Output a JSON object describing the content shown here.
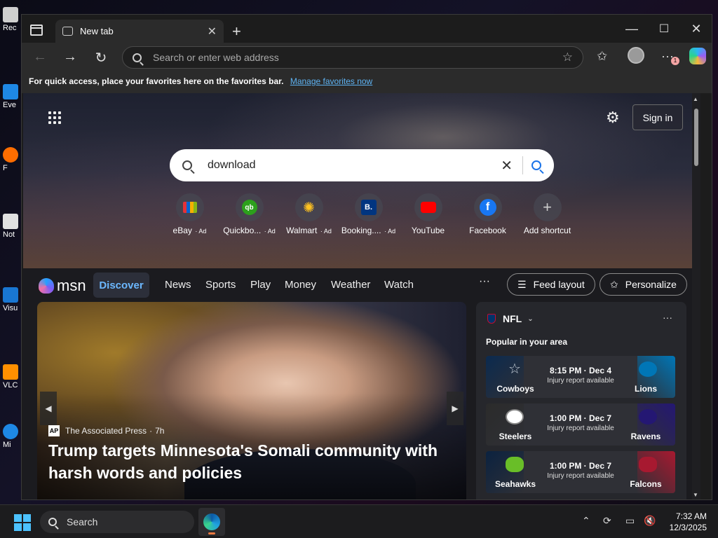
{
  "desktop": {
    "icons": [
      {
        "label": "Rec",
        "color": "#cfcfcf"
      },
      {
        "label": "Eve",
        "color": "#1e88e5"
      },
      {
        "label": "F",
        "color": "#ff6d00"
      },
      {
        "label": "Not",
        "color": "#e0e0e0"
      },
      {
        "label": "Visu",
        "color": "#1976d2"
      },
      {
        "label": "VLC",
        "color": "#ff8f00"
      },
      {
        "label": "Mi",
        "color": "#1e88e5"
      }
    ]
  },
  "browser": {
    "tab": {
      "title": "New tab"
    },
    "address": {
      "placeholder": "Search or enter web address"
    },
    "favbar": {
      "text": "For quick access, place your favorites here on the favorites bar.",
      "link": "Manage favorites now"
    },
    "notification_count": "1"
  },
  "newtab": {
    "sign_in": "Sign in",
    "search": {
      "value": "download"
    },
    "shortcuts": [
      {
        "label": "eBay",
        "ad": "Ad",
        "icon": "ebay-icon"
      },
      {
        "label": "Quickbo...",
        "ad": "Ad",
        "icon": "quickbooks-icon"
      },
      {
        "label": "Walmart",
        "ad": "Ad",
        "icon": "walmart-icon"
      },
      {
        "label": "Booking....",
        "ad": "Ad",
        "icon": "booking-icon"
      },
      {
        "label": "YouTube",
        "ad": "",
        "icon": "youtube-icon"
      },
      {
        "label": "Facebook",
        "ad": "",
        "icon": "facebook-icon"
      },
      {
        "label": "Add shortcut",
        "ad": "",
        "icon": "plus-icon"
      }
    ]
  },
  "msn": {
    "logo": "msn",
    "nav": [
      "Discover",
      "News",
      "Sports",
      "Play",
      "Money",
      "Weather",
      "Watch"
    ],
    "more": "···",
    "feed_layout": "Feed layout",
    "personalize": "Personalize",
    "feature": {
      "source": "The Associated Press",
      "age": "7h",
      "headline": "Trump targets Minnesota's Somali community with harsh words and policies"
    },
    "nfl": {
      "title": "NFL",
      "subtitle": "Popular in your area",
      "games": [
        {
          "home": "Cowboys",
          "away": "Lions",
          "time": "8:15 PM · Dec 4",
          "note": "Injury report available",
          "home_color": "#0b2a4f",
          "away_color": "#0076b6"
        },
        {
          "home": "Steelers",
          "away": "Ravens",
          "time": "1:00 PM · Dec 7",
          "note": "Injury report available",
          "home_color": "#2b2b2b",
          "away_color": "#241773"
        },
        {
          "home": "Seahawks",
          "away": "Falcons",
          "time": "1:00 PM · Dec 7",
          "note": "Injury report available",
          "home_color": "#0b2240",
          "away_color": "#a71930"
        }
      ]
    }
  },
  "taskbar": {
    "search": "Search",
    "time": "7:32 AM",
    "date": "12/3/2025"
  }
}
